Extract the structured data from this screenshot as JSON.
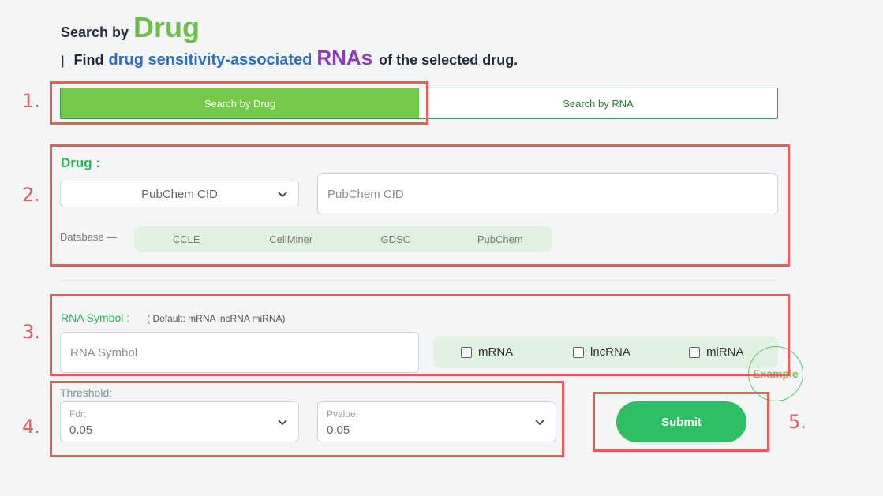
{
  "header": {
    "title_prefix": "Search by",
    "title_main": "Drug",
    "separator": "|",
    "subtitle_find": "Find",
    "subtitle_blue": "drug sensitivity-associated",
    "subtitle_purple": "RNAs",
    "subtitle_end": "of the selected drug."
  },
  "annotations": [
    "1.",
    "2.",
    "3.",
    "4.",
    "5."
  ],
  "tabs": [
    {
      "label": "Search by Drug",
      "active": true
    },
    {
      "label": "Search by RNA",
      "active": false
    }
  ],
  "drug": {
    "label": "Drug :",
    "id_type_selected": "PubChem CID",
    "input_placeholder": "PubChem CID",
    "database_label": "Database —",
    "databases": [
      "CCLE",
      "CellMiner",
      "GDSC",
      "PubChem"
    ]
  },
  "rna": {
    "label": "RNA Symbol :",
    "hint": "( Default:  mRNA lncRNA miRNA)",
    "input_placeholder": "RNA Symbol",
    "types": [
      "mRNA",
      "lncRNA",
      "miRNA"
    ],
    "example_label": "Example"
  },
  "threshold": {
    "label": "Threshold:",
    "fdr_label": "Fdr:",
    "fdr_value": "0.05",
    "pvalue_label": "Pvalue:",
    "pvalue_value": "0.05"
  },
  "submit_label": "Submit",
  "colors": {
    "accent_green": "#76c84a",
    "title_green": "#6cc04a",
    "label_green": "#2ab35a",
    "blue": "#2f6fc3",
    "purple": "#8a3fb5",
    "annotation_red": "#e85c5c",
    "submit_green": "#2dbf64"
  }
}
